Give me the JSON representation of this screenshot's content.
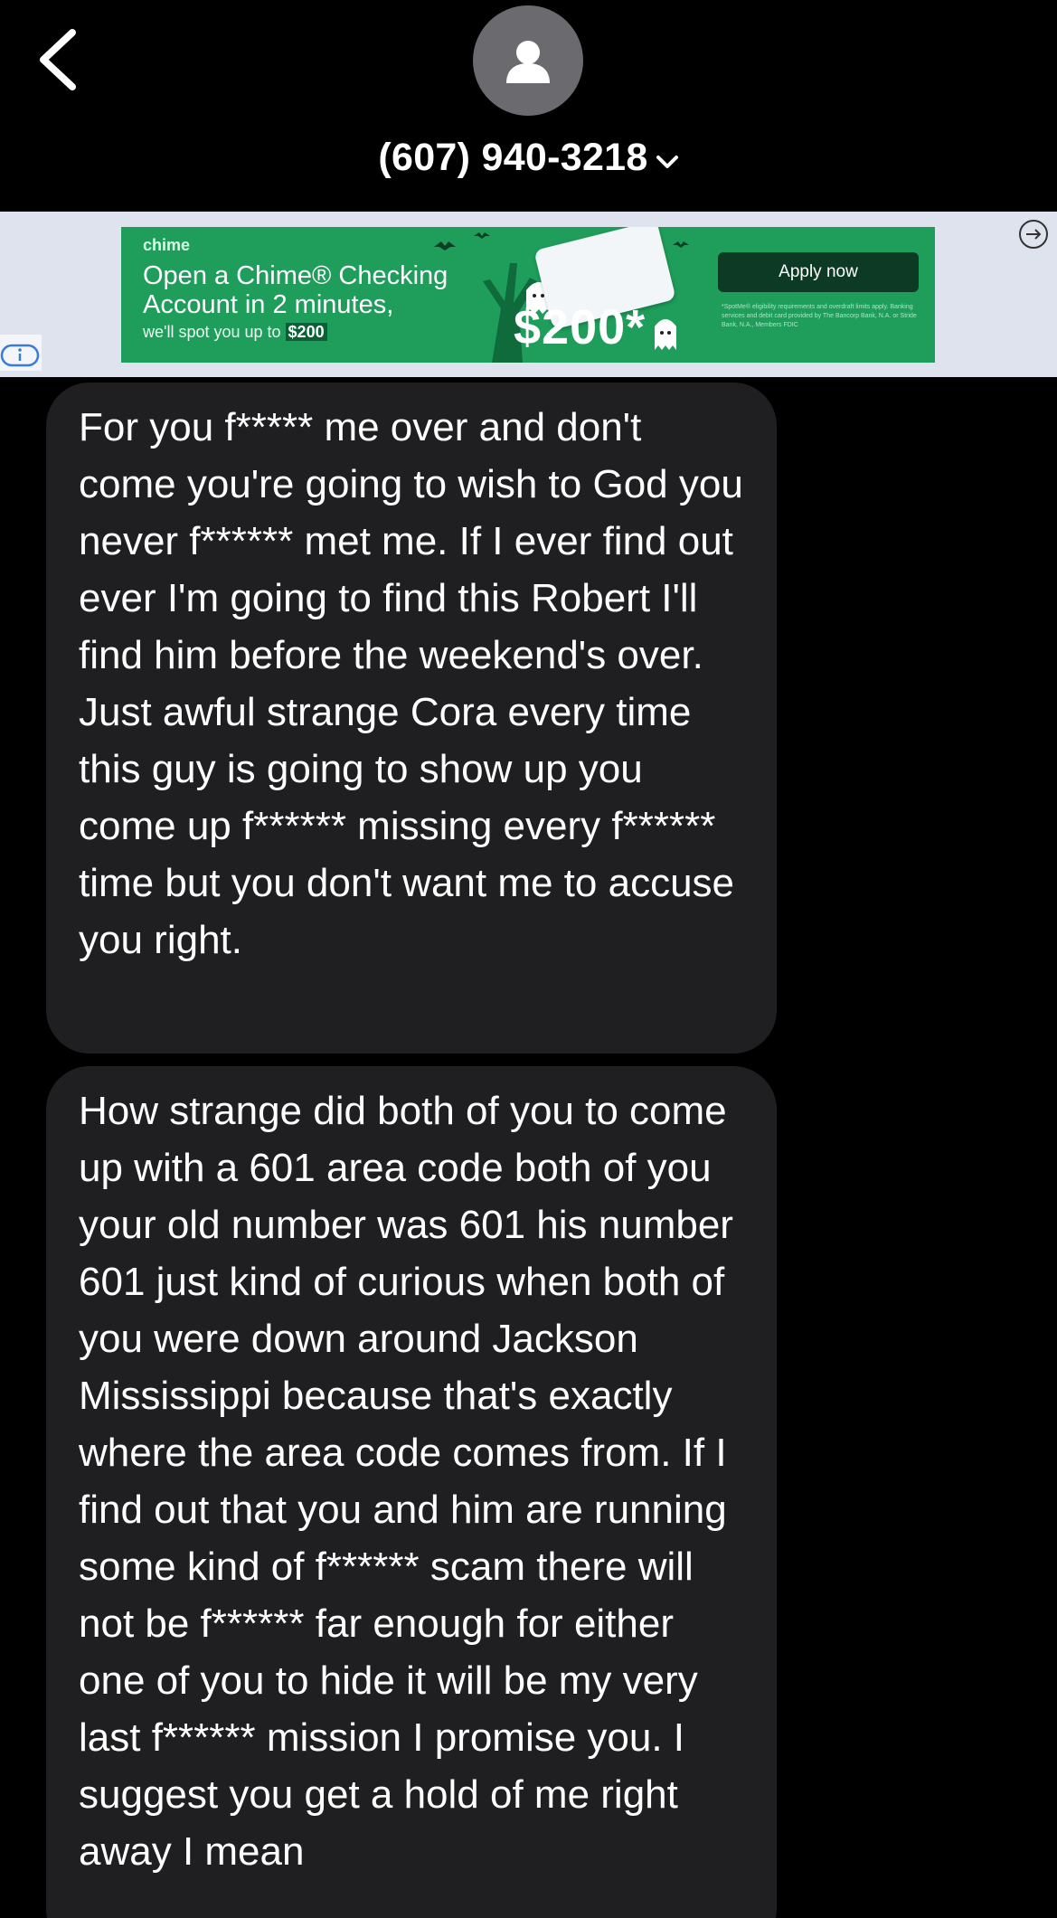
{
  "header": {
    "back_icon": "chevron-left-icon",
    "avatar_icon": "person-icon",
    "contact_name": "(607) 940-3218",
    "title_chevron_icon": "chevron-down-icon"
  },
  "ad": {
    "brand": "chime",
    "headline": "Open a Chime® Checking Account in 2 minutes,",
    "subtext_prefix": "we'll spot you up to",
    "subtext_amount": "$200",
    "amount_graphic": "$200*",
    "cta_label": "Apply now",
    "fine_print": "*SpotMe® eligibility requirements and overdraft limits apply. Banking services and debit card provided by The Bancorp Bank, N.A. or Stride Bank, N.A., Members FDIC",
    "info_icon": "info-icon",
    "arrow_icon": "arrow-right-circle-icon",
    "colors": {
      "ad_green": "#1e9e5a",
      "ad_cta": "#0d3a24",
      "banner_bg": "#dfe3ee"
    }
  },
  "messages": [
    {
      "direction": "incoming",
      "text": "For you f***** me over and don't come you're going to wish to God you never f****** met me. If I ever find out ever I'm going to find this Robert I'll find him before the weekend's over. Just awful strange Cora every time this guy is going to show up you come up f****** missing every f****** time but you don't want me to accuse you right."
    },
    {
      "direction": "incoming",
      "text": "How strange did both of you to come up with a 601 area code both of you your old number was 601 his number 601 just kind of curious when both of you were down around Jackson Mississippi because that's exactly where the area code comes from. If I find out that you and him are running some kind of f****** scam there will not be f****** far enough for either one of you to hide it will be my very last f****** mission I promise you. I suggest you get a hold of me right away I mean"
    }
  ],
  "colors": {
    "background": "#000000",
    "bubble_incoming": "#1f1f21",
    "text": "#ffffff",
    "avatar_bg": "#6b6b6f"
  }
}
